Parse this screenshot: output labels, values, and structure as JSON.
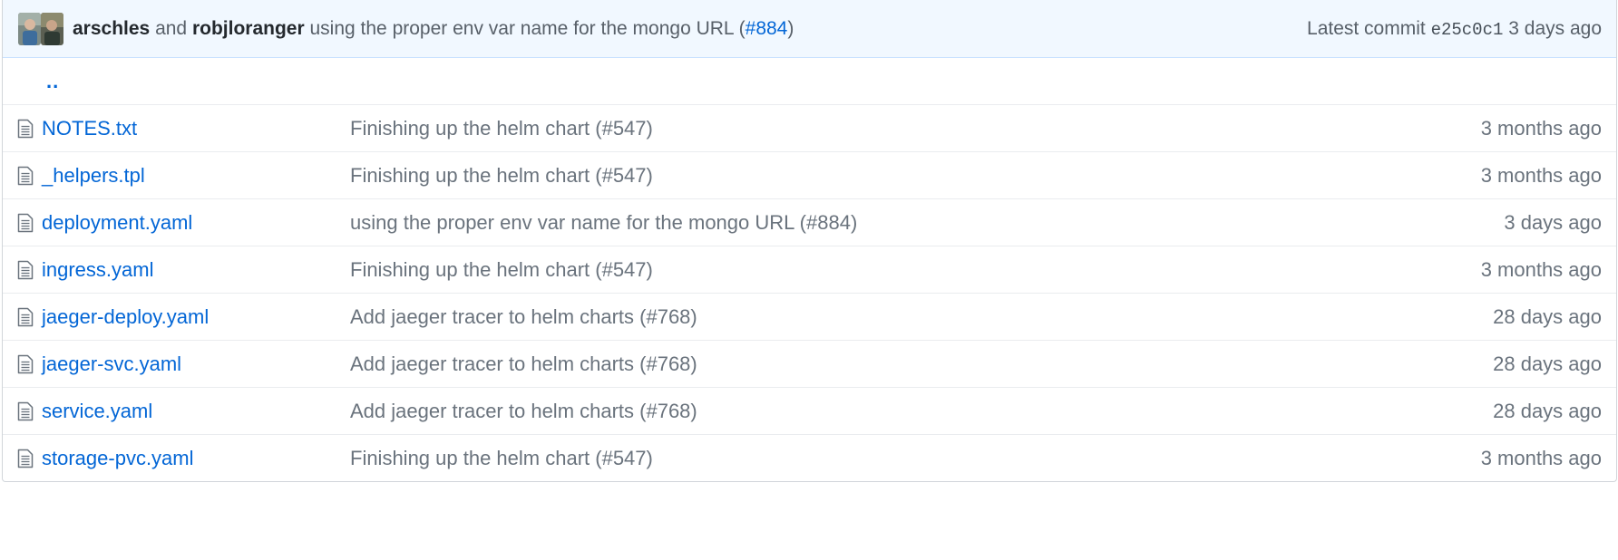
{
  "commit": {
    "author1": "arschles",
    "conjunction": "and",
    "author2": "robjloranger",
    "message_text": "using the proper env var name for the mongo URL (",
    "message_pr": "#884",
    "message_close": ")",
    "latest_label": "Latest commit",
    "sha": "e25c0c1",
    "age": "3 days ago"
  },
  "up_link": "..",
  "files": [
    {
      "name": "NOTES.txt",
      "message": "Finishing up the helm chart (#547)",
      "age": "3 months ago"
    },
    {
      "name": "_helpers.tpl",
      "message": "Finishing up the helm chart (#547)",
      "age": "3 months ago"
    },
    {
      "name": "deployment.yaml",
      "message": "using the proper env var name for the mongo URL (#884)",
      "age": "3 days ago"
    },
    {
      "name": "ingress.yaml",
      "message": "Finishing up the helm chart (#547)",
      "age": "3 months ago"
    },
    {
      "name": "jaeger-deploy.yaml",
      "message": "Add jaeger tracer to helm charts (#768)",
      "age": "28 days ago"
    },
    {
      "name": "jaeger-svc.yaml",
      "message": "Add jaeger tracer to helm charts (#768)",
      "age": "28 days ago"
    },
    {
      "name": "service.yaml",
      "message": "Add jaeger tracer to helm charts (#768)",
      "age": "28 days ago"
    },
    {
      "name": "storage-pvc.yaml",
      "message": "Finishing up the helm chart (#547)",
      "age": "3 months ago"
    }
  ],
  "colors": {
    "link": "#0366d6",
    "muted": "#6a737d",
    "commit_bar_bg": "#f1f8ff"
  },
  "icons": {
    "file": "file-icon"
  }
}
